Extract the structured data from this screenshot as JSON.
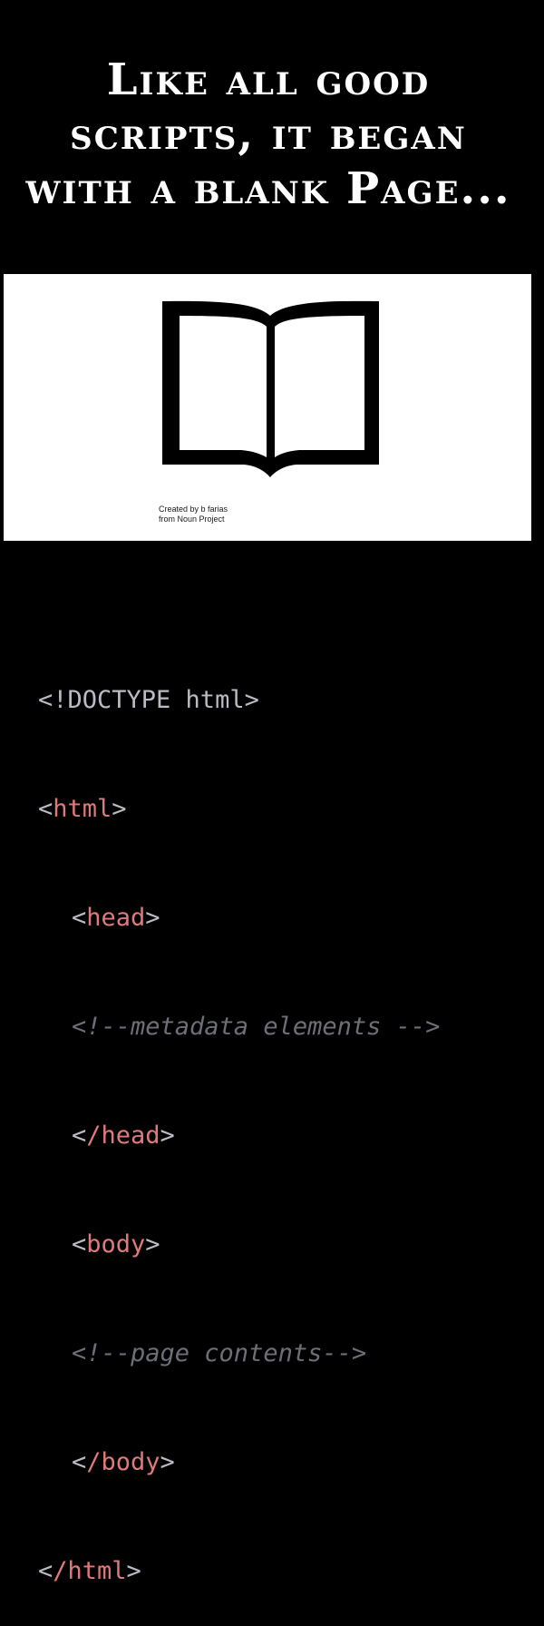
{
  "headline": {
    "line1": "Like all good",
    "line2": "scripts, it began",
    "line3": "with a blank Page..."
  },
  "image": {
    "icon": "open-book-icon",
    "credit_line1": "Created by b farias",
    "credit_line2": "from Noun Project"
  },
  "code": {
    "doctype": "<!DOCTYPE html>",
    "html_open_tag": "html",
    "head_open_tag": "head",
    "metadata_comment": "<!--metadata elements -->",
    "head_close_tag": "/head",
    "body_open_tag": "body",
    "page_comment": "<!--page contents-->",
    "body_close_tag": "/body",
    "html_close_tag": "/html",
    "open_bracket": "<",
    "close_bracket": ">"
  },
  "colors": {
    "background": "#000000",
    "text": "#ffffff",
    "code_punct": "#b9bcc4",
    "code_tag": "#e07a7a",
    "code_comment": "#6c6f78"
  }
}
